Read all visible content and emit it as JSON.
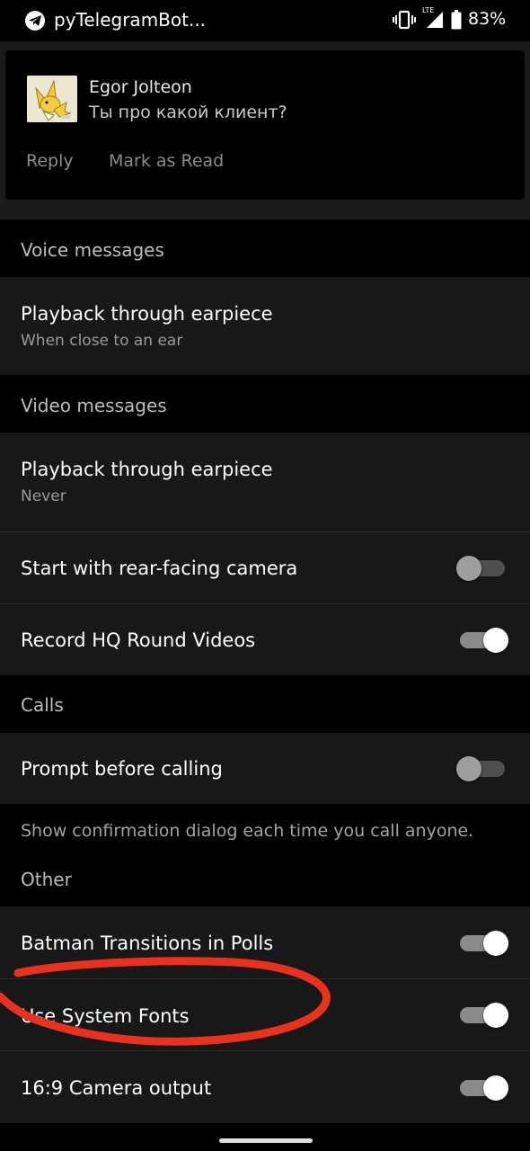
{
  "status_bar": {
    "app_name": "pyTelegramBot...",
    "network": "LTE",
    "battery": "83%",
    "icons": [
      "telegram-icon",
      "vibrate-icon",
      "signal-icon",
      "battery-icon"
    ]
  },
  "notification": {
    "sender": "Egor Jolteon",
    "message": "Ты про какой клиент?",
    "actions": {
      "reply": "Reply",
      "mark_read": "Mark as Read"
    }
  },
  "sections": {
    "voice": {
      "header": "Voice messages",
      "earpiece": {
        "title": "Playback through earpiece",
        "subtitle": "When close to an ear"
      }
    },
    "video": {
      "header": "Video messages",
      "earpiece": {
        "title": "Playback through earpiece",
        "subtitle": "Never"
      },
      "rear_camera": {
        "title": "Start with rear-facing camera",
        "enabled": false
      },
      "hq_round": {
        "title": "Record HQ Round Videos",
        "enabled": true
      }
    },
    "calls": {
      "header": "Calls",
      "prompt": {
        "title": "Prompt before calling",
        "enabled": false
      },
      "info": "Show confirmation dialog each time you call anyone."
    },
    "other": {
      "header": "Other",
      "batman": {
        "title": "Batman Transitions in Polls",
        "enabled": true
      },
      "system_fonts": {
        "title": "Use System Fonts",
        "enabled": true
      },
      "camera_output": {
        "title": "16:9 Camera output",
        "enabled": true
      }
    }
  },
  "colors": {
    "background": "#000000",
    "row_background": "#181818",
    "annotation": "#e8321e"
  }
}
